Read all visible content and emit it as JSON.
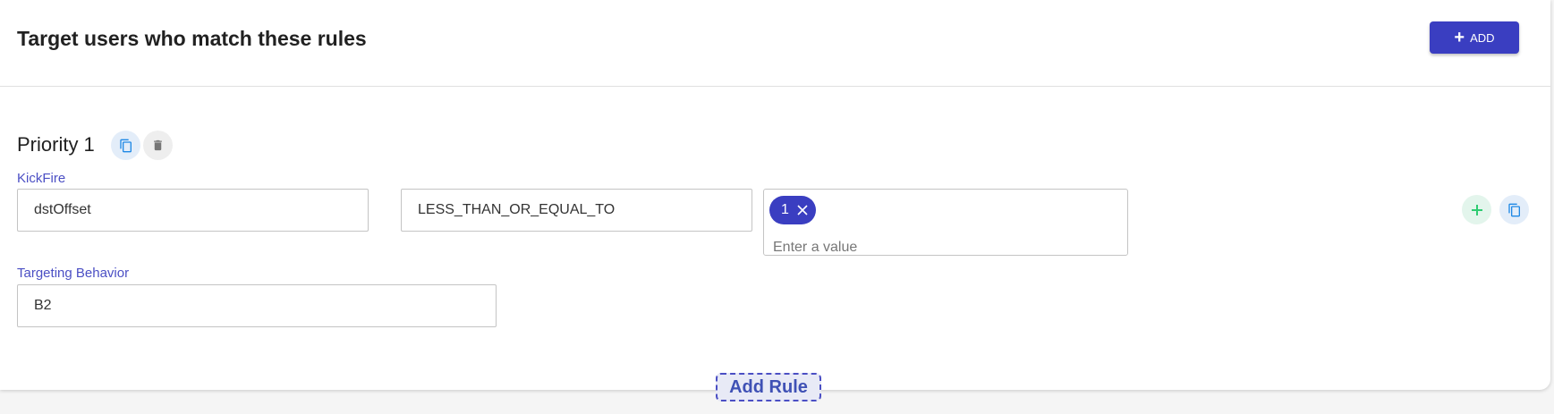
{
  "header": {
    "title": "Target users who match these rules",
    "add_button_label": "ADD"
  },
  "rule": {
    "priority_label": "Priority 1",
    "condition": {
      "section_label": "KickFire",
      "attribute_value": "dstOffset",
      "operator_value": "LESS_THAN_OR_EQUAL_TO",
      "chips": [
        "1"
      ],
      "value_placeholder": "Enter a value"
    },
    "targeting": {
      "label": "Targeting Behavior",
      "value": "B2"
    }
  },
  "footer": {
    "add_rule_label": "Add Rule"
  },
  "colors": {
    "accent": "#3a3ec1",
    "label": "#4b4fc4",
    "add_green": "#2ecc71",
    "copy_blue": "#1e88e5"
  },
  "icons": [
    "plus-icon",
    "copy-icon",
    "delete-icon",
    "close-icon"
  ]
}
